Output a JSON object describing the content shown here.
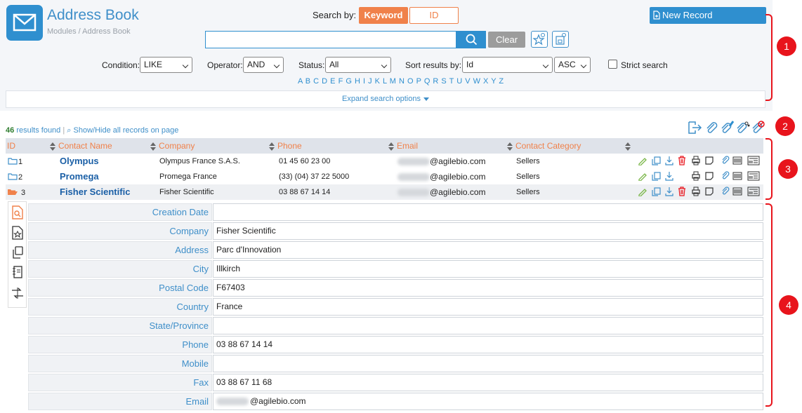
{
  "header": {
    "title": "Address Book",
    "breadcrumb": "Modules / Address Book"
  },
  "search": {
    "search_by_label": "Search by:",
    "mode_keyword": "Keyword",
    "mode_id": "ID",
    "query": "",
    "clear_label": "Clear",
    "new_record_label": "New Record",
    "condition_label": "Condition:",
    "condition_value": "LIKE",
    "operator_label": "Operator:",
    "operator_value": "AND",
    "status_label": "Status:",
    "status_value": "All",
    "sort_label": "Sort results by:",
    "sort_value": "Id",
    "order_value": "ASC",
    "strict_label": "Strict search",
    "alphabet": "A B C D E F G H I J K L M N O P Q R S T U V W X Y Z",
    "expand_label": "Expand search options"
  },
  "annotations": [
    "1",
    "2",
    "3",
    "4"
  ],
  "results": {
    "count": "46",
    "found_label": "results found",
    "show_hide_label": "Show/Hide all records on page"
  },
  "table": {
    "headers": [
      "ID",
      "Contact Name",
      "Company",
      "Phone",
      "Email",
      "Contact Category"
    ],
    "rows": [
      {
        "id": "1",
        "name": "Olympus",
        "company": "Olympus France S.A.S.",
        "phone": "01 45 60 23 00",
        "email": "@agilebio.com",
        "category": "Sellers"
      },
      {
        "id": "2",
        "name": "Promega",
        "company": "Promega France",
        "phone": "(33) (04) 37 22 5000",
        "email": "@agilebio.com",
        "category": "Sellers"
      },
      {
        "id": "3",
        "name": "Fisher Scientific",
        "company": "Fisher Scientific",
        "phone": "03 88 67 14 14",
        "email": "@agilebio.com",
        "category": "Sellers"
      }
    ]
  },
  "detail": {
    "fields": [
      {
        "label": "Creation Date",
        "value": ""
      },
      {
        "label": "Company",
        "value": "Fisher Scientific"
      },
      {
        "label": "Address",
        "value": "Parc d'Innovation"
      },
      {
        "label": "City",
        "value": "Illkirch"
      },
      {
        "label": "Postal Code",
        "value": "F67403"
      },
      {
        "label": "Country",
        "value": "France"
      },
      {
        "label": "State/Province",
        "value": ""
      },
      {
        "label": "Phone",
        "value": "03 88 67 14 14"
      },
      {
        "label": "Mobile",
        "value": ""
      },
      {
        "label": "Fax",
        "value": "03 88 67 11 68"
      },
      {
        "label": "Email",
        "value": "@agilebio.com"
      }
    ]
  },
  "colors": {
    "accent": "#2f8fcf",
    "orange": "#f0814a",
    "annotation": "#e8141c"
  }
}
